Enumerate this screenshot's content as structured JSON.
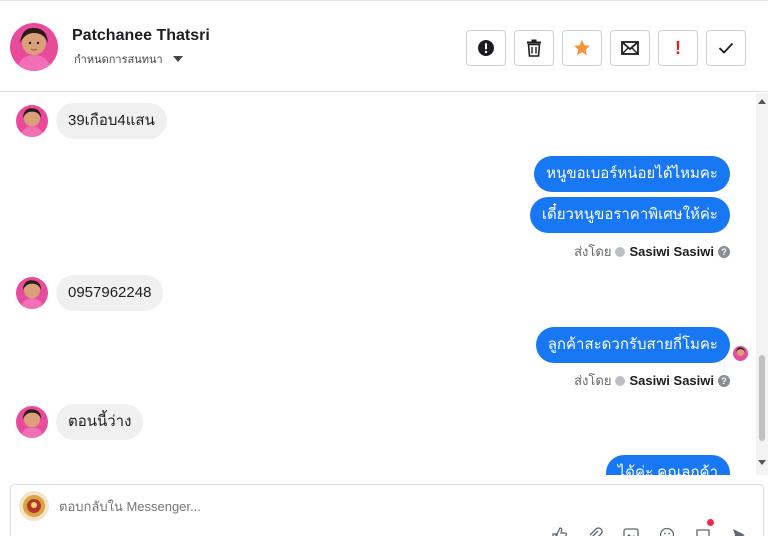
{
  "header": {
    "name": "Patchanee Thatsri",
    "subtitle": "กำหนดการสนทนา",
    "toolbar": [
      {
        "name": "alert-circle-icon"
      },
      {
        "name": "trash-icon"
      },
      {
        "name": "star-icon",
        "color": "#f7923b"
      },
      {
        "name": "mail-icon"
      },
      {
        "name": "spam-icon",
        "label": "!",
        "color": "#e02020"
      },
      {
        "name": "check-icon"
      }
    ]
  },
  "thread": {
    "messages": [
      {
        "dir": "in",
        "text": "39เกือบ4แสน"
      },
      {
        "dir": "out",
        "text": "หนูขอเบอร์หน่อยได้ไหมคะ"
      },
      {
        "dir": "out",
        "text": "เดี๋ยวหนูขอราคาพิเศษให้ค่ะ"
      },
      {
        "dir": "meta",
        "prefix": "ส่งโดย",
        "who": "Sasiwi Sasiwi"
      },
      {
        "dir": "in",
        "text": "0957962248"
      },
      {
        "dir": "out",
        "text": "ลูกค้าสะดวกรับสายกี่โมคะ"
      },
      {
        "dir": "meta",
        "prefix": "ส่งโดย",
        "who": "Sasiwi Sasiwi"
      },
      {
        "dir": "in",
        "text": "ตอนนี้ว่าง"
      },
      {
        "dir": "out",
        "text": "ได้ค่ะ คุณลูกค้า"
      }
    ],
    "help_glyph": "?"
  },
  "composer": {
    "placeholder": "ตอบกลับใน Messenger..."
  },
  "colors": {
    "accent": "#1877f2",
    "bubble_in": "#f0f0f0"
  }
}
